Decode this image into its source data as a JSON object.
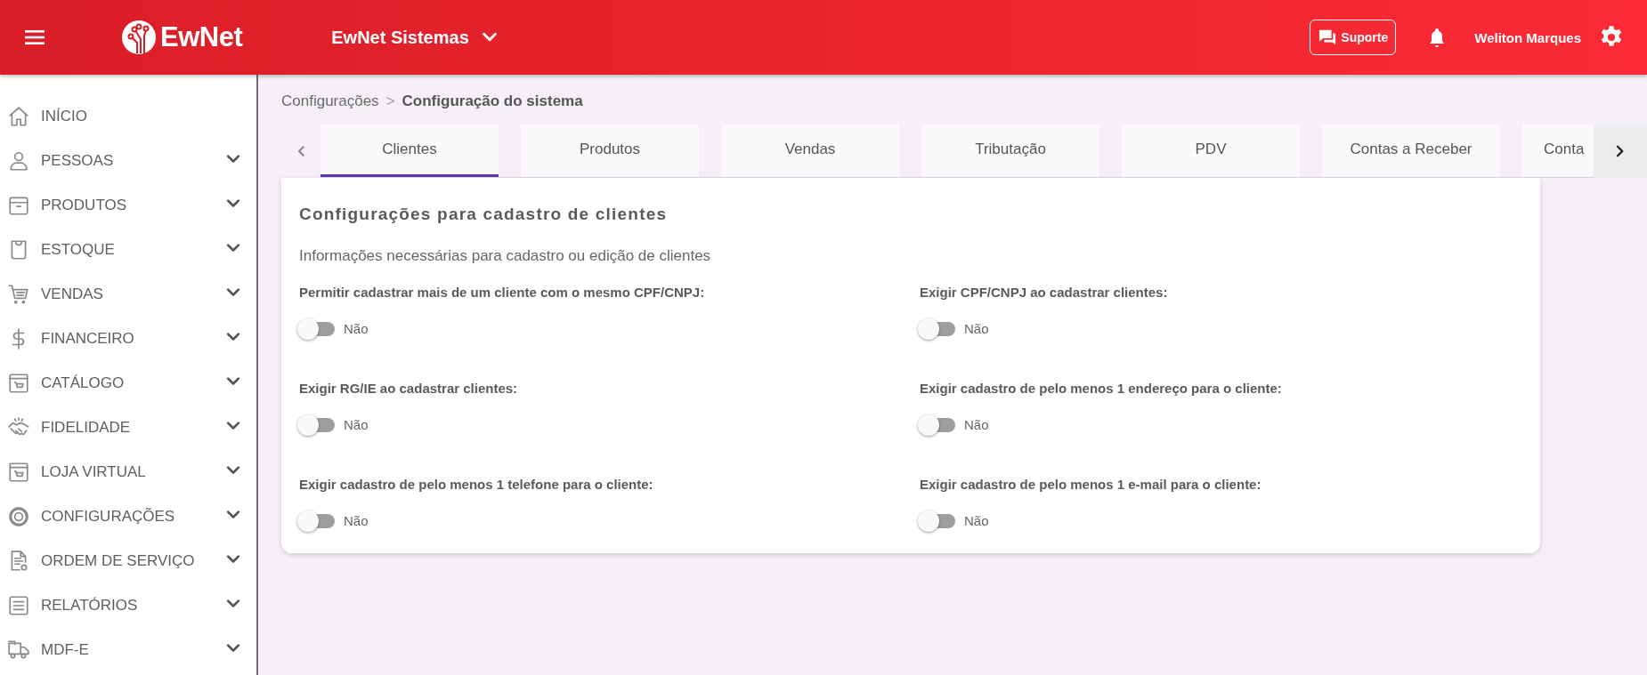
{
  "header": {
    "brand": "EwNet",
    "company": "EwNet Sistemas",
    "support": "Suporte",
    "user": "Weliton Marques"
  },
  "sidebar": {
    "items": [
      {
        "label": "INÍCIO",
        "expandable": false
      },
      {
        "label": "PESSOAS",
        "expandable": true
      },
      {
        "label": "PRODUTOS",
        "expandable": true
      },
      {
        "label": "ESTOQUE",
        "expandable": true
      },
      {
        "label": "VENDAS",
        "expandable": true
      },
      {
        "label": "FINANCEIRO",
        "expandable": true
      },
      {
        "label": "CATÁLOGO",
        "expandable": true
      },
      {
        "label": "FIDELIDADE",
        "expandable": true
      },
      {
        "label": "LOJA VIRTUAL",
        "expandable": true
      },
      {
        "label": "CONFIGURAÇÕES",
        "expandable": true
      },
      {
        "label": "ORDEM DE SERVIÇO",
        "expandable": true
      },
      {
        "label": "RELATÓRIOS",
        "expandable": true
      },
      {
        "label": "MDF-E",
        "expandable": true
      }
    ]
  },
  "breadcrumb": {
    "parent": "Configurações",
    "separator": ">",
    "current": "Configuração do sistema"
  },
  "tabs": [
    {
      "label": "Clientes",
      "selected": true
    },
    {
      "label": "Produtos",
      "selected": false
    },
    {
      "label": "Vendas",
      "selected": false
    },
    {
      "label": "Tributação",
      "selected": false
    },
    {
      "label": "PDV",
      "selected": false
    },
    {
      "label": "Contas a Receber",
      "selected": false
    },
    {
      "label": "Conta",
      "selected": false
    }
  ],
  "card": {
    "title": "Configurações para cadastro de clientes",
    "subtitle": "Informações necessárias para cadastro ou edição de clientes",
    "settings": [
      {
        "label": "Permitir cadastrar mais de um cliente com o mesmo CPF/CNPJ:",
        "on": false,
        "value": "Não"
      },
      {
        "label": "Exigir CPF/CNPJ ao cadastrar clientes:",
        "on": false,
        "value": "Não"
      },
      {
        "label": "Exigir RG/IE ao cadastrar clientes:",
        "on": false,
        "value": "Não"
      },
      {
        "label": "Exigir cadastro de pelo menos 1 endereço para o cliente:",
        "on": false,
        "value": "Não"
      },
      {
        "label": "Exigir cadastro de pelo menos 1 telefone para o cliente:",
        "on": false,
        "value": "Não"
      },
      {
        "label": "Exigir cadastro de pelo menos 1 e-mail para o cliente:",
        "on": false,
        "value": "Não"
      }
    ]
  }
}
